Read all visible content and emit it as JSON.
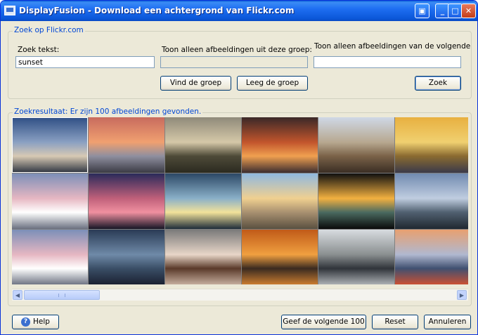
{
  "window": {
    "title": "DisplayFusion - Download een achtergrond van Flickr.com",
    "controls": {
      "extra": "▣",
      "minimize": "_",
      "maximize": "□",
      "close": "✕"
    }
  },
  "search_group": {
    "title": "Zoek op Flickr.com",
    "search_label": "Zoek tekst:",
    "search_value": "sunset",
    "group_label": "Toon alleen afbeeldingen uit deze groep:",
    "group_value": "",
    "user_label": "Toon alleen afbeeldingen van de volgende",
    "user_value": "",
    "find_group_button": "Vind de groep",
    "clear_group_button": "Leeg de groep",
    "search_button": "Zoek"
  },
  "results": {
    "title": "Zoekresultaat: Er zijn 100 afbeeldingen gevonden.",
    "thumbnails": [
      {
        "colors": [
          "#2f4f85",
          "#8aa0c2",
          "#d7c9b4",
          "#2d3440"
        ]
      },
      {
        "colors": [
          "#c86b5e",
          "#f0a070",
          "#8f8f9f",
          "#3a3a44"
        ]
      },
      {
        "colors": [
          "#8f8a7a",
          "#d5c8a8",
          "#4e4a38",
          "#2b2a20"
        ]
      },
      {
        "colors": [
          "#3a2828",
          "#c2552c",
          "#f0a050",
          "#3a2c30"
        ]
      },
      {
        "colors": [
          "#cfd8e6",
          "#b7a890",
          "#7a6248",
          "#3a2e24"
        ]
      },
      {
        "colors": [
          "#e8b040",
          "#f0d070",
          "#8a6a30",
          "#3a3a4a"
        ]
      },
      {
        "colors": [
          "#7c8fb8",
          "#e6b7c2",
          "#ffffff",
          "#6a7080"
        ]
      },
      {
        "colors": [
          "#2a2a5a",
          "#c0607a",
          "#f090a0",
          "#151525"
        ]
      },
      {
        "colors": [
          "#2c4866",
          "#8ab0c8",
          "#f2e29a",
          "#1e2c3a"
        ]
      },
      {
        "colors": [
          "#90b8e0",
          "#f0d090",
          "#a89070",
          "#5a5040"
        ]
      },
      {
        "colors": [
          "#101010",
          "#f2b040",
          "#4a6a60",
          "#0a0a0a"
        ]
      },
      {
        "colors": [
          "#708ab0",
          "#c0cde0",
          "#506070",
          "#202830"
        ]
      },
      {
        "colors": [
          "#7c8fb8",
          "#e6b7c2",
          "#ffffff",
          "#6a7080"
        ]
      },
      {
        "colors": [
          "#2a3b55",
          "#6f8aa8",
          "#3a4e66",
          "#1a2030"
        ]
      },
      {
        "colors": [
          "#7a7a7a",
          "#e8d6c8",
          "#5a3a2a",
          "#c8b0a0"
        ]
      },
      {
        "colors": [
          "#c05a18",
          "#f0a040",
          "#3a2a20",
          "#d08030"
        ]
      },
      {
        "colors": [
          "#d8dce0",
          "#8a8f90",
          "#30343a",
          "#b0b4b8"
        ]
      },
      {
        "colors": [
          "#e8a070",
          "#b0b8d0",
          "#405070",
          "#d05030"
        ]
      }
    ]
  },
  "footer": {
    "help_button": "Help",
    "next_button": "Geef de volgende 100",
    "reset_button": "Reset",
    "cancel_button": "Annuleren"
  }
}
